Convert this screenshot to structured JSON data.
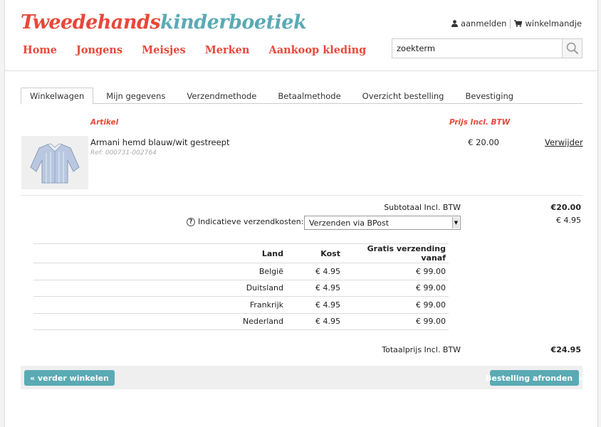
{
  "brand": {
    "part1": "Tweedehands",
    "part2": "kinderboetiek"
  },
  "topnav": {
    "login": "aanmelden",
    "cart": "winkelmandje"
  },
  "mainnav": [
    "Home",
    "Jongens",
    "Meisjes",
    "Merken",
    "Aankoop kleding"
  ],
  "search": {
    "value": "zoekterm"
  },
  "tabs": [
    "Winkelwagen",
    "Mijn gegevens",
    "Verzendmethode",
    "Betaalmethode",
    "Overzicht bestelling",
    "Bevestiging"
  ],
  "cart": {
    "col_article": "Artikel",
    "col_price": "Prijs Incl. BTW",
    "item": {
      "name": "Armani hemd blauw/wit gestreept",
      "ref": "Ref: 000731-002764",
      "price": "€ 20.00",
      "remove": "Verwijder"
    },
    "subtotal_label": "Subtotaal Incl. BTW",
    "subtotal_value": "€20.00",
    "shipping_label": "Indicatieve verzendkosten:",
    "shipping_option": "Verzenden via BPost",
    "shipping_value": "€ 4.95",
    "total_label": "Totaalprijs Incl. BTW",
    "total_value": "€24.95"
  },
  "shipping_table": {
    "headers": [
      "Land",
      "Kost",
      "Gratis verzending vanaf"
    ],
    "rows": [
      [
        "België",
        "€ 4.95",
        "€ 99.00"
      ],
      [
        "Duitsland",
        "€ 4.95",
        "€ 99.00"
      ],
      [
        "Frankrijk",
        "€ 4.95",
        "€ 99.00"
      ],
      [
        "Nederland",
        "€ 4.95",
        "€ 99.00"
      ]
    ]
  },
  "actions": {
    "continue": "« verder winkelen",
    "checkout": "Bestelling afronden  »"
  },
  "colors": {
    "brand_red": "#e8483a",
    "brand_teal": "#5aaab4"
  }
}
